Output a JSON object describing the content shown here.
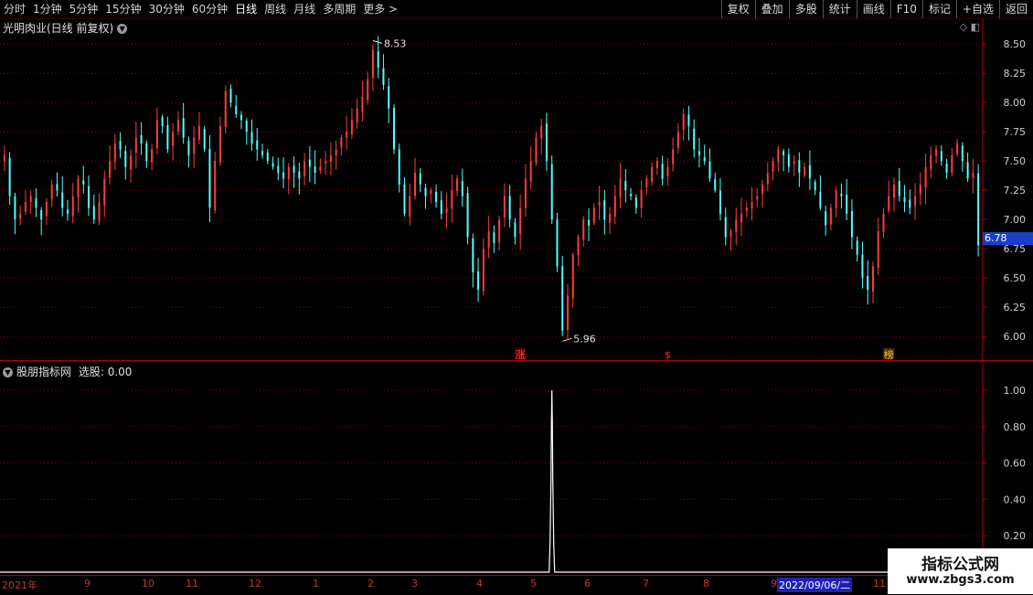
{
  "toolbar": {
    "periods": [
      "分时",
      "1分钟",
      "5分钟",
      "15分钟",
      "30分钟",
      "60分钟",
      "日线",
      "周线",
      "月线",
      "多周期",
      "更多"
    ],
    "active_period": "日线",
    "buttons": [
      "复权",
      "叠加",
      "多股",
      "统计",
      "画线",
      "F10",
      "标记",
      "+自选",
      "返回"
    ]
  },
  "main": {
    "title": "光明肉业(日线 前复权)",
    "high_label": "8.53",
    "low_label": "5.96",
    "current_price": "6.78",
    "markers": [
      {
        "text": "涨",
        "color": "#ff4040"
      },
      {
        "text": "$",
        "color": "#ff2020"
      },
      {
        "text": "榜",
        "color": "#ffc040"
      }
    ]
  },
  "indicator": {
    "title": "股朋指标网",
    "value_label": "选股: 0.00"
  },
  "date_axis": {
    "labels": [
      "2021年",
      "9",
      "10",
      "11",
      "12",
      "1",
      "2",
      "3",
      "4",
      "5",
      "6",
      "7",
      "8",
      "9",
      "11"
    ],
    "selected": "2022/09/06/二"
  },
  "watermark": {
    "line1": "指标公式网",
    "line2": "www.zbgs3.com"
  },
  "colors": {
    "up": "#ff3c3c",
    "down": "#54ffff",
    "grid": "#8a0000",
    "indicator": "#ffffff"
  },
  "chart_data": [
    {
      "type": "candlestick",
      "title": "光明肉业(日线 前复权)",
      "y_ticks": [
        "8.50",
        "8.25",
        "8.00",
        "7.75",
        "7.50",
        "7.25",
        "7.00",
        "6.75",
        "6.50",
        "6.25",
        "6.00"
      ],
      "ylim": [
        5.9,
        8.65
      ],
      "close_series": [
        7.55,
        7.2,
        7.0,
        7.05,
        7.15,
        7.2,
        7.1,
        7.0,
        7.15,
        7.3,
        7.25,
        7.1,
        7.05,
        7.2,
        7.35,
        7.3,
        7.1,
        7.0,
        7.15,
        7.35,
        7.5,
        7.65,
        7.6,
        7.45,
        7.55,
        7.7,
        7.65,
        7.5,
        7.6,
        7.85,
        7.8,
        7.6,
        7.75,
        7.85,
        7.7,
        7.55,
        7.7,
        7.8,
        7.6,
        7.1,
        7.5,
        7.8,
        8.1,
        8.0,
        7.9,
        7.85,
        7.75,
        7.65,
        7.6,
        7.55,
        7.5,
        7.45,
        7.4,
        7.35,
        7.45,
        7.4,
        7.35,
        7.5,
        7.45,
        7.4,
        7.45,
        7.5,
        7.55,
        7.6,
        7.7,
        7.75,
        7.85,
        7.95,
        8.05,
        8.2,
        8.45,
        8.3,
        8.15,
        7.95,
        7.6,
        7.3,
        7.05,
        7.2,
        7.4,
        7.3,
        7.2,
        7.25,
        7.15,
        7.05,
        7.1,
        7.25,
        7.35,
        7.2,
        6.85,
        6.55,
        6.4,
        6.75,
        6.9,
        6.8,
        7.0,
        7.2,
        7.0,
        6.85,
        7.1,
        7.35,
        7.5,
        7.7,
        7.8,
        7.5,
        7.0,
        6.6,
        6.05,
        6.35,
        6.7,
        6.85,
        7.0,
        6.95,
        7.1,
        7.15,
        7.0,
        7.05,
        7.2,
        7.35,
        7.25,
        7.2,
        7.1,
        7.25,
        7.35,
        7.45,
        7.5,
        7.35,
        7.45,
        7.6,
        7.75,
        7.9,
        7.8,
        7.6,
        7.55,
        7.5,
        7.35,
        7.25,
        7.05,
        6.85,
        6.9,
        7.0,
        7.05,
        7.1,
        7.15,
        7.2,
        7.3,
        7.4,
        7.5,
        7.6,
        7.55,
        7.45,
        7.5,
        7.4,
        7.45,
        7.35,
        7.25,
        7.1,
        6.95,
        7.1,
        7.25,
        7.2,
        7.05,
        6.85,
        6.7,
        6.5,
        6.4,
        6.6,
        6.9,
        7.05,
        7.2,
        7.3,
        7.2,
        7.15,
        7.1,
        7.2,
        7.3,
        7.45,
        7.55,
        7.6,
        7.5,
        7.4,
        7.55,
        7.65,
        7.5,
        7.35,
        7.4,
        6.78
      ]
    },
    {
      "type": "line",
      "title": "股朋指标网",
      "y_ticks": [
        "1.00",
        "0.80",
        "0.60",
        "0.40",
        "0.20"
      ],
      "ylim": [
        0,
        1.05
      ],
      "spike": {
        "index": 104,
        "values": [
          0.16,
          0.5,
          0.82,
          1.0
        ]
      },
      "baseline": 0.0
    }
  ]
}
